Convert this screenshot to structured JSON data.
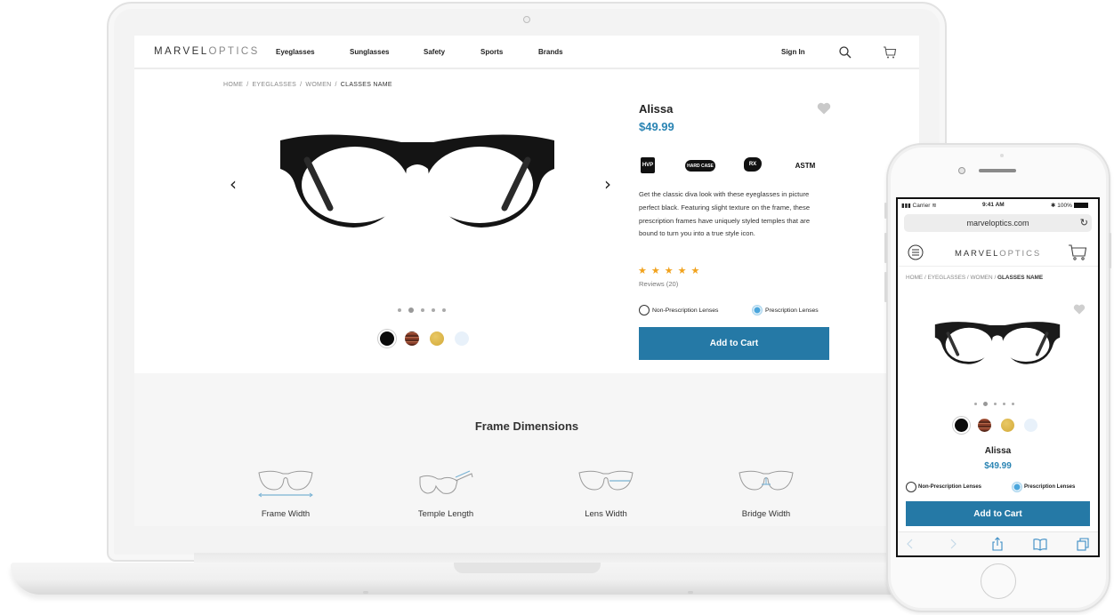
{
  "desktop": {
    "brand": {
      "bold": "MARVEL",
      "light": "OPTICS"
    },
    "nav": {
      "items": [
        "Eyeglasses",
        "Sunglasses",
        "Safety",
        "Sports",
        "Brands"
      ],
      "sign_in": "Sign In",
      "icons": [
        "search-icon",
        "cart-icon"
      ]
    },
    "breadcrumb": [
      "HOME",
      "EYEGLASSES",
      "WOMEN",
      "CLASSES NAME"
    ],
    "breadcrumb_sep": "/",
    "gallery": {
      "prev": "‹",
      "next": "›",
      "dot_count": 5,
      "active_dot": 2
    },
    "swatches": [
      {
        "name": "black",
        "color": "#0a0a0a",
        "selected": true
      },
      {
        "name": "tortoise",
        "color": "#8a3f2a",
        "selected": false
      },
      {
        "name": "gold",
        "color": "#d3aa3a",
        "selected": false
      },
      {
        "name": "clear",
        "color": "#e8f1fa",
        "selected": false
      }
    ],
    "product": {
      "name": "Alissa",
      "price": "$49.99",
      "badges": [
        "HVP",
        "HARD CASE",
        "RX",
        "ASTM"
      ],
      "description": "Get the classic diva look with these eyeglasses in picture perfect black. Featuring slight texture on the frame, these prescription frames have uniquely styled temples that are bound to turn you into a true style icon.",
      "stars": "★★★★★",
      "rating": 5,
      "reviews": "Reviews (20)",
      "lens_options": [
        {
          "label": "Non-Prescription Lenses",
          "selected": false
        },
        {
          "label": "Prescription Lenses",
          "selected": true
        }
      ],
      "add_to_cart": "Add to Cart"
    },
    "dimensions": {
      "title": "Frame Dimensions",
      "items": [
        "Frame Width",
        "Temple Length",
        "Lens Width",
        "Bridge Width"
      ]
    }
  },
  "mobile": {
    "status": {
      "carrier": "Carrier",
      "time": "9:41 AM",
      "battery": "100%"
    },
    "url": "marveloptics.com",
    "reload": "↻",
    "brand": {
      "bold": "MARVEL",
      "light": "OPTICS"
    },
    "breadcrumb": [
      "HOME",
      "EYEGLASSES",
      "WOMEN",
      "GLASSES NAME"
    ],
    "product": {
      "name": "Alissa",
      "price": "$49.99",
      "lens_options": [
        {
          "label": "Non-Prescription Lenses",
          "selected": false
        },
        {
          "label": "Prescription Lenses",
          "selected": true
        }
      ],
      "add_to_cart": "Add to Cart"
    },
    "toolbar": [
      "back-icon",
      "forward-icon",
      "share-icon",
      "bookmarks-icon",
      "tabs-icon"
    ]
  },
  "colors": {
    "accent": "#2579a6",
    "price": "#2a84b3",
    "star": "#f1a21d",
    "section_bg": "#f6f6f6"
  }
}
